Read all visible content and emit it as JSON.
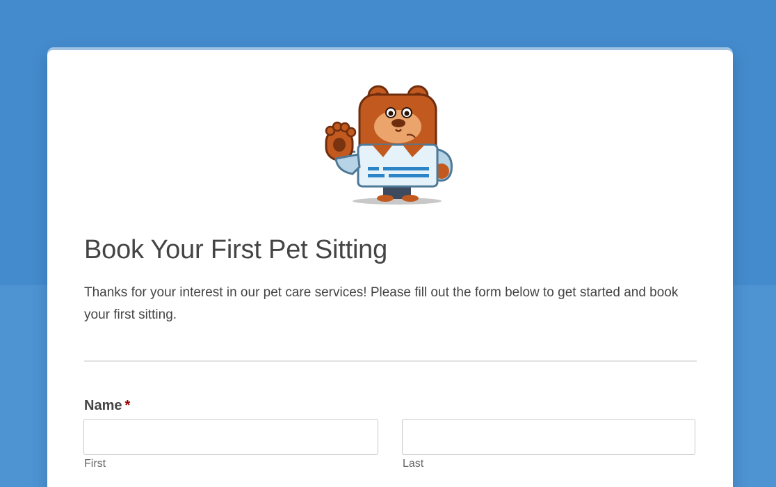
{
  "colors": {
    "background": "#448bcd",
    "card": "#ffffff",
    "card_accent": "#a9cbea",
    "text": "#444444",
    "required_marker": "#990000"
  },
  "form": {
    "mascot_icon": "bear-mascot-waving-icon",
    "title": "Book Your First Pet Sitting",
    "description": "Thanks for your interest in our pet care services! Please fill out the form below to get started and book your first sitting.",
    "fields": {
      "name": {
        "label": "Name",
        "required_marker": "*",
        "first": {
          "value": "",
          "placeholder": "",
          "sublabel": "First"
        },
        "last": {
          "value": "",
          "placeholder": "",
          "sublabel": "Last"
        }
      }
    }
  }
}
